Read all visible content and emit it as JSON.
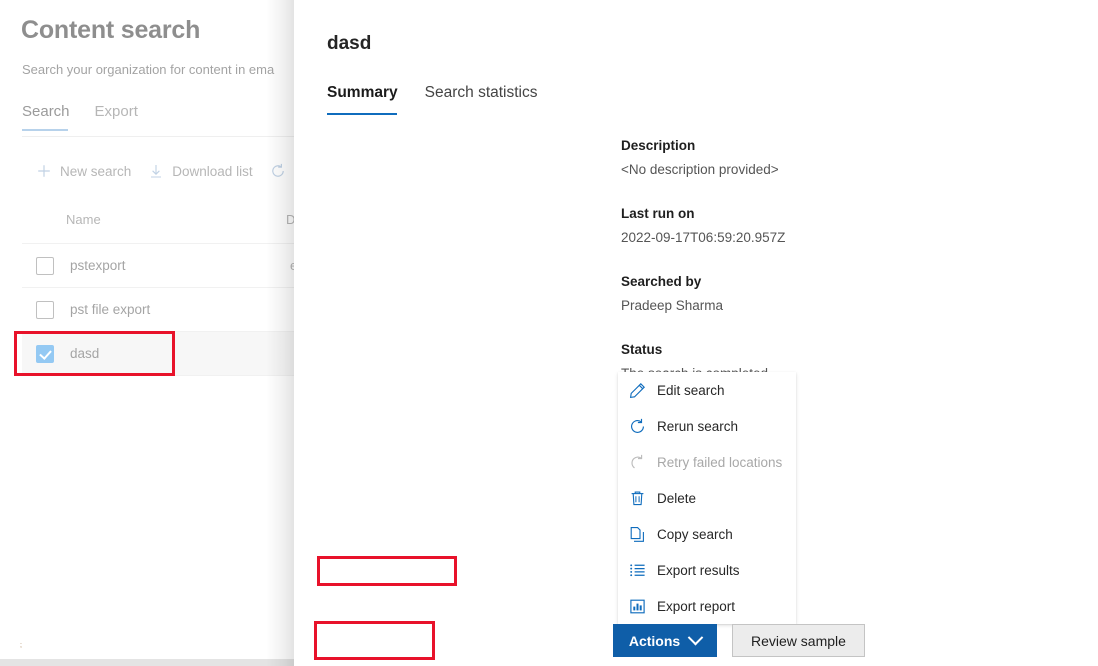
{
  "background_page": {
    "title": "Content search",
    "subtitle": "Search your organization for content in ema",
    "tabs": [
      {
        "label": "Search",
        "active": true
      },
      {
        "label": "Export",
        "active": false
      }
    ],
    "toolbar": [
      {
        "label": "New search",
        "icon": "plus-icon"
      },
      {
        "label": "Download list",
        "icon": "download-icon"
      },
      {
        "label": "",
        "icon": "refresh-icon"
      }
    ],
    "table": {
      "columns": [
        "Name",
        "D"
      ],
      "rows": [
        {
          "name": "pstexport",
          "d": "e",
          "checked": false,
          "selected": false
        },
        {
          "name": "pst file export",
          "d": "",
          "checked": false,
          "selected": false
        },
        {
          "name": "dasd",
          "d": "",
          "checked": true,
          "selected": true
        }
      ]
    },
    "artifact": ";"
  },
  "flyout": {
    "title": "dasd",
    "tabs": [
      {
        "label": "Summary",
        "active": true
      },
      {
        "label": "Search statistics",
        "active": false
      }
    ],
    "fields": [
      {
        "label": "Description",
        "value": "<No description provided>"
      },
      {
        "label": "Last run on",
        "value": "2022-09-17T06:59:20.957Z"
      },
      {
        "label": "Searched by",
        "value": "Pradeep Sharma"
      },
      {
        "label": "Status",
        "value": "The search is completed"
      }
    ],
    "footer": {
      "primary": "Actions",
      "secondary": "Review sample"
    }
  },
  "context_menu": {
    "items": [
      {
        "label": "Edit search",
        "icon": "pencil-icon",
        "disabled": false
      },
      {
        "label": "Rerun search",
        "icon": "refresh-icon",
        "disabled": false
      },
      {
        "label": "Retry failed locations",
        "icon": "retry-icon",
        "disabled": true
      },
      {
        "label": "Delete",
        "icon": "trash-icon",
        "disabled": false
      },
      {
        "label": "Copy search",
        "icon": "copy-icon",
        "disabled": false
      },
      {
        "label": "Export results",
        "icon": "list-icon",
        "disabled": false
      },
      {
        "label": "Export report",
        "icon": "report-icon",
        "disabled": false
      }
    ]
  },
  "highlights": {
    "row": "dasd-row-highlight",
    "export_results": "export-results-highlight",
    "actions": "actions-button-highlight"
  },
  "colors": {
    "accent_blue": "#0f6cbd",
    "primary_button": "#0f5ea8",
    "checkbox_checked": "#54a9ec",
    "highlight_red": "#e8122a",
    "bg_tab_underline": "#8cb7e0"
  }
}
